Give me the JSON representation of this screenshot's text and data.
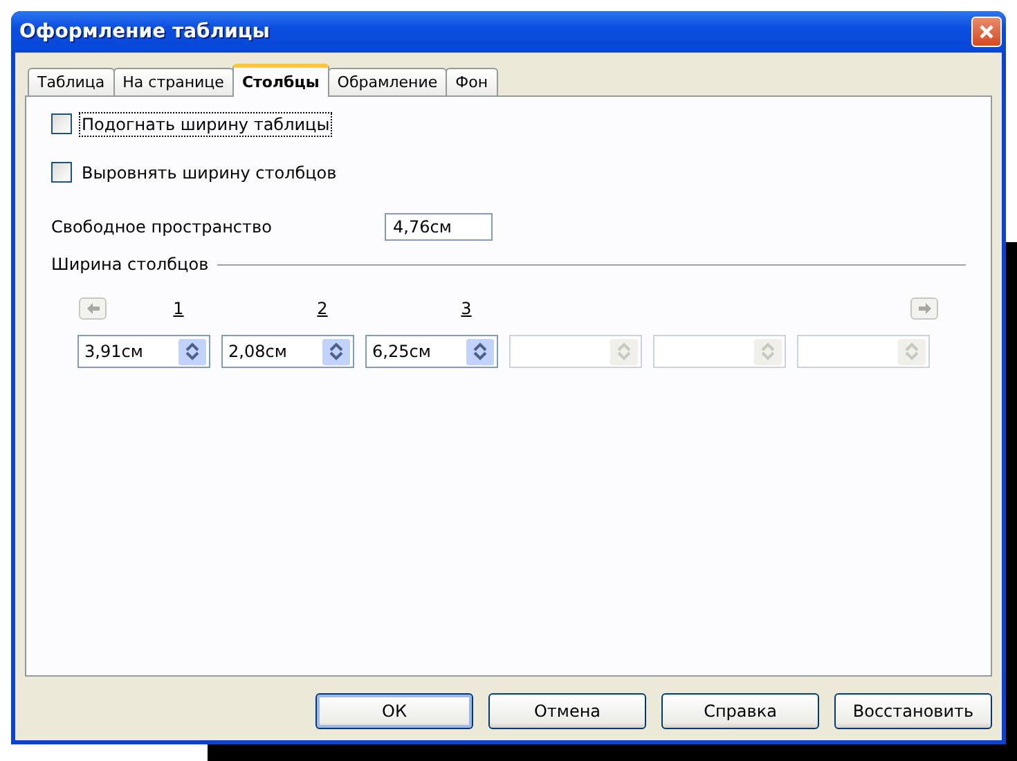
{
  "window": {
    "title": "Оформление таблицы"
  },
  "tabs": [
    {
      "label": "Таблица",
      "selected": false
    },
    {
      "label": "На странице",
      "selected": false
    },
    {
      "label": "Столбцы",
      "selected": true
    },
    {
      "label": "Обрамление",
      "selected": false
    },
    {
      "label": "Фон",
      "selected": false
    }
  ],
  "options": [
    {
      "label": "Подогнать ширину таблицы",
      "checked": false,
      "focused": true
    },
    {
      "label": "Выровнять ширину столбцов",
      "checked": false,
      "focused": false
    }
  ],
  "free_space": {
    "label": "Свободное пространство",
    "value": "4,76см"
  },
  "column_widths": {
    "title": "Ширина столбцов",
    "columns": [
      "1",
      "2",
      "3"
    ],
    "fields": [
      {
        "value": "3,91см",
        "disabled": false
      },
      {
        "value": "2,08см",
        "disabled": false
      },
      {
        "value": "6,25см",
        "disabled": false
      },
      {
        "disabled": true
      },
      {
        "disabled": true
      },
      {
        "disabled": true
      }
    ]
  },
  "buttons": [
    {
      "label": "ОК",
      "default": true
    },
    {
      "label": "Отмена",
      "default": false
    },
    {
      "label": "Справка",
      "default": false
    },
    {
      "label": "Восстановить",
      "default": false
    }
  ]
}
